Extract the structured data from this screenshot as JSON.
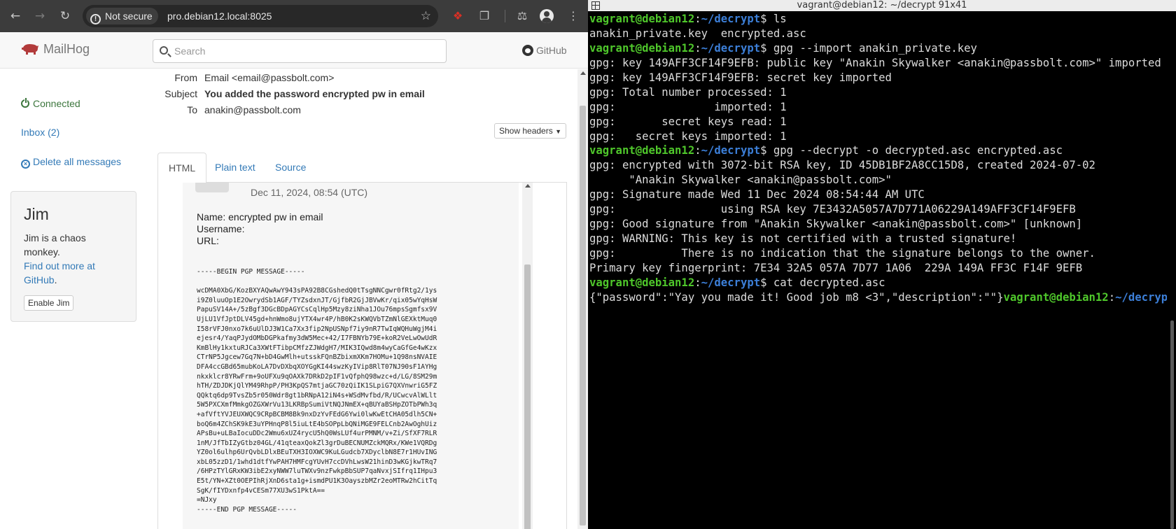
{
  "browser": {
    "security_label": "Not secure",
    "url": "pro.debian12.local:8025"
  },
  "mailhog": {
    "brand": "MailHog",
    "search_placeholder": "Search",
    "github_label": "GitHub",
    "sidebar": {
      "connected": "Connected",
      "inbox": "Inbox (2)",
      "delete_all": "Delete all messages"
    },
    "jim": {
      "title": "Jim",
      "description": "Jim is a chaos monkey.",
      "link": "Find out more at GitHub",
      "link_suffix": ".",
      "button": "Enable Jim"
    },
    "message": {
      "from_label": "From",
      "from": "Email <email@passbolt.com>",
      "subject_label": "Subject",
      "subject": "You added the password encrypted pw in email",
      "to_label": "To",
      "to": "anakin@passbolt.com",
      "show_headers": "Show headers"
    },
    "tabs": [
      "HTML",
      "Plain text",
      "Source"
    ],
    "preview": {
      "date": "Dec 11, 2024, 08:54 (UTC)",
      "name_line": "Name: encrypted pw in email",
      "username_line": "Username:",
      "url_line": "URL:",
      "pgp_lines": [
        "-----BEGIN PGP MESSAGE-----",
        "",
        "wcDMA0XbG/KozBXYAQwAwY943sPA92B8CGshedQ0tTsgNNCgwr0fRtg2/1ys",
        "i9Z0luuOp1E2OwrydSb1AGF/TYZsdxnJT/GjfbR2GjJBVwKr/qix05wYqHsW",
        "PapuSV14A+/5zBgf3DGcBDpAGYCsCqlHp5Mzy8ziNha1JOu76mpsSgmfsx9V",
        "UjLU1VfJptDLV45gd+hnWmo8ujYTX4wr4P/hB0K2sKWQVbTZmNlGEXktMuq0",
        "I58rVFJ0nxo7k6uUlDJ3W1Ca7Xx3fip2NpUSNpf7iy9nR7TwIqWQHuWgjM4i",
        "ejesr4/YaqPJydOMbDGPkafmy3dW5Mec+42/I7FBNYb79E+koR2VeLwOwUdR",
        "KmBlHy1kxtuRJCa3XWtFTibpCMfzZJWdgH7/MIK3IQwd8m4wyCaGfGe4wKzx",
        "CTrNP5Jgcew7Gq7N+bD4GwMlh+utsskFQnBZbixmXKm7HOMu+1Q98nsNVAIE",
        "DFA4ccGBd65mubKoLA7DvDXbqXOYGgKI44swzKyIVip8RlT07NJ90sF1AYHg",
        "nkxklcr8YRwFrm+9oUFXu9qOAXk7DRkD2pIF1vQfphQ98wzc+d/LG/8SM29m",
        "hTH/ZDJDKjQlYM49RhpP/PH3KpQS7mtjaGC70zQiIK1SLpiG7QXVnwriG5FZ",
        "QQktq6dp9TvsZb5r050Wdr8gt1bRNpA12iN4s+WSdMvfbd/R/UCwcvAlWLlt",
        "5W5PXCXmfMmkgOZGXWrVu13LKRBpSumiVtNQJNmEX+qBUYaBSHpZOTbPWh3q",
        "+afVftYVJEUXWQC9CRpBCBM8Bk9nxDzYvFEdG6Ywi0lwKwEtCHA05dlh5CN+",
        "boQ6m4ZChSK9kE3uYPHnqP8l5iuLtE4bSOPpLbQNiMGE9FELCnb2AwOghUiz",
        "APsBu+uLBaIocuDDc2Wmu6xUZ4rycU5hQ0WsLUf4urPMNM/v+Zi/SfXF7RLR",
        "1nM/JfTbIZyGtbz04GL/41qteaxQokZl3grDuBECNUMZckMQRx/KWe1VQRDg",
        "YZ0ol6ulhp6UrQvbLDlxBEuTXH3IOXWC9KuLGudcb7XDyclbN8E7r1HUvING",
        "xbL05zzD1/1whd1dtfYwPAH7HMFcgYUvH7ccDVhLwsW21hinD3wKGjkwTRq7",
        "/6HPzTYlGRxKW3ibE2xyNWW7luTWXv9nzFwkpBbSUP7qaNvxjSIfrq1IHpu3",
        "E5t/YN+XZt0OEPIhRjXnD6sta1g+ismdPU1K3OayszbMZr2eoMTRw2hCitTq",
        "SgK/fIYDxnfp4vCESm77XU3wS1PktA==",
        "=NJxy",
        "-----END PGP MESSAGE-----"
      ]
    }
  },
  "terminal": {
    "title": "vagrant@debian12: ~/decrypt 91x41",
    "prompt_user": "vagrant@debian12",
    "prompt_sep": ":",
    "prompt_path": "~/decrypt",
    "prompt_end": "$ ",
    "lines": [
      {
        "kind": "cmd",
        "text": "ls"
      },
      {
        "kind": "out",
        "text": "anakin_private.key  encrypted.asc"
      },
      {
        "kind": "cmd",
        "text": "gpg --import anakin_private.key"
      },
      {
        "kind": "out",
        "text": "gpg: key 149AFF3CF14F9EFB: public key \"Anakin Skywalker <anakin@passbolt.com>\" imported"
      },
      {
        "kind": "out",
        "text": "gpg: key 149AFF3CF14F9EFB: secret key imported"
      },
      {
        "kind": "out",
        "text": "gpg: Total number processed: 1"
      },
      {
        "kind": "out",
        "text": "gpg:               imported: 1"
      },
      {
        "kind": "out",
        "text": "gpg:       secret keys read: 1"
      },
      {
        "kind": "out",
        "text": "gpg:   secret keys imported: 1"
      },
      {
        "kind": "cmd",
        "text": "gpg --decrypt -o decrypted.asc encrypted.asc"
      },
      {
        "kind": "out",
        "text": "gpg: encrypted with 3072-bit RSA key, ID 45DB1BF2A8CC15D8, created 2024-07-02"
      },
      {
        "kind": "out",
        "text": "      \"Anakin Skywalker <anakin@passbolt.com>\""
      },
      {
        "kind": "out",
        "text": "gpg: Signature made Wed 11 Dec 2024 08:54:44 AM UTC"
      },
      {
        "kind": "out",
        "text": "gpg:                using RSA key 7E3432A5057A7D771A06229A149AFF3CF14F9EFB"
      },
      {
        "kind": "out",
        "text": "gpg: Good signature from \"Anakin Skywalker <anakin@passbolt.com>\" [unknown]"
      },
      {
        "kind": "out",
        "text": "gpg: WARNING: This key is not certified with a trusted signature!"
      },
      {
        "kind": "out",
        "text": "gpg:          There is no indication that the signature belongs to the owner."
      },
      {
        "kind": "out",
        "text": "Primary key fingerprint: 7E34 32A5 057A 7D77 1A06  229A 149A FF3C F14F 9EFB"
      },
      {
        "kind": "cmd",
        "text": "cat decrypted.asc"
      },
      {
        "kind": "outprompt",
        "text": "{\"password\":\"Yay you made it! Good job m8 <3\",\"description\":\"\"}"
      }
    ]
  },
  "colors": {
    "prompt_user": "#4fc72b",
    "prompt_path": "#3c7fd8",
    "link": "#337ab7"
  }
}
